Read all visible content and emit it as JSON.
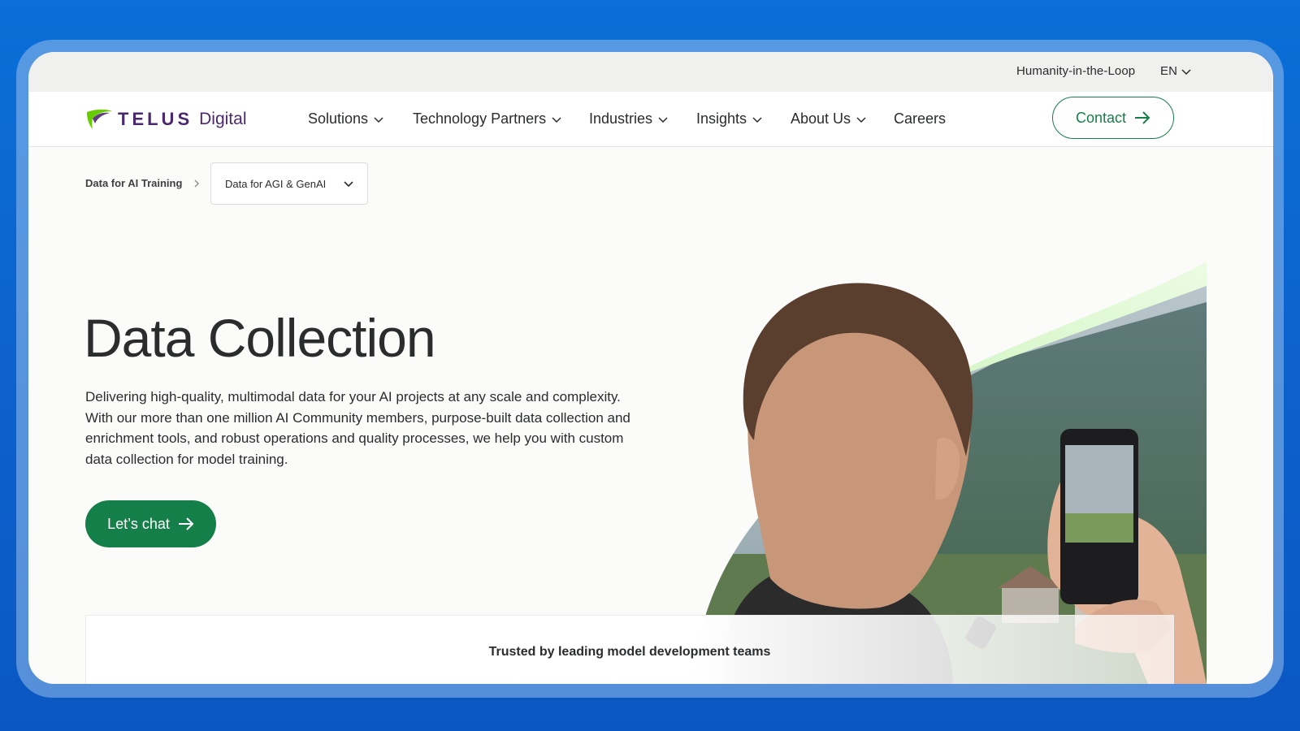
{
  "utility": {
    "humanity_link": "Humanity-in-the-Loop",
    "language": "EN"
  },
  "brand": {
    "wordmark": "TELUS",
    "sub": "Digital",
    "primary_color": "#4b286d",
    "accent_green": "#66cc00"
  },
  "nav": {
    "items": [
      {
        "label": "Solutions",
        "has_dropdown": true
      },
      {
        "label": "Technology Partners",
        "has_dropdown": true
      },
      {
        "label": "Industries",
        "has_dropdown": true
      },
      {
        "label": "Insights",
        "has_dropdown": true
      },
      {
        "label": "About Us",
        "has_dropdown": true
      },
      {
        "label": "Careers",
        "has_dropdown": false
      }
    ],
    "contact_label": "Contact"
  },
  "breadcrumb": {
    "parent": "Data for AI Training",
    "current": "Data for AGI & GenAI"
  },
  "hero": {
    "title": "Data Collection",
    "description": "Delivering high-quality, multimodal data for your AI projects at any scale and complexity. With our more than one million AI Community members, purpose-built data collection and enrichment tools, and robust operations and quality processes, we help you with custom data collection for model training.",
    "cta_label": "Let’s chat",
    "cta_color": "#157f4a"
  },
  "trust": {
    "heading": "Trusted by leading model development teams"
  }
}
